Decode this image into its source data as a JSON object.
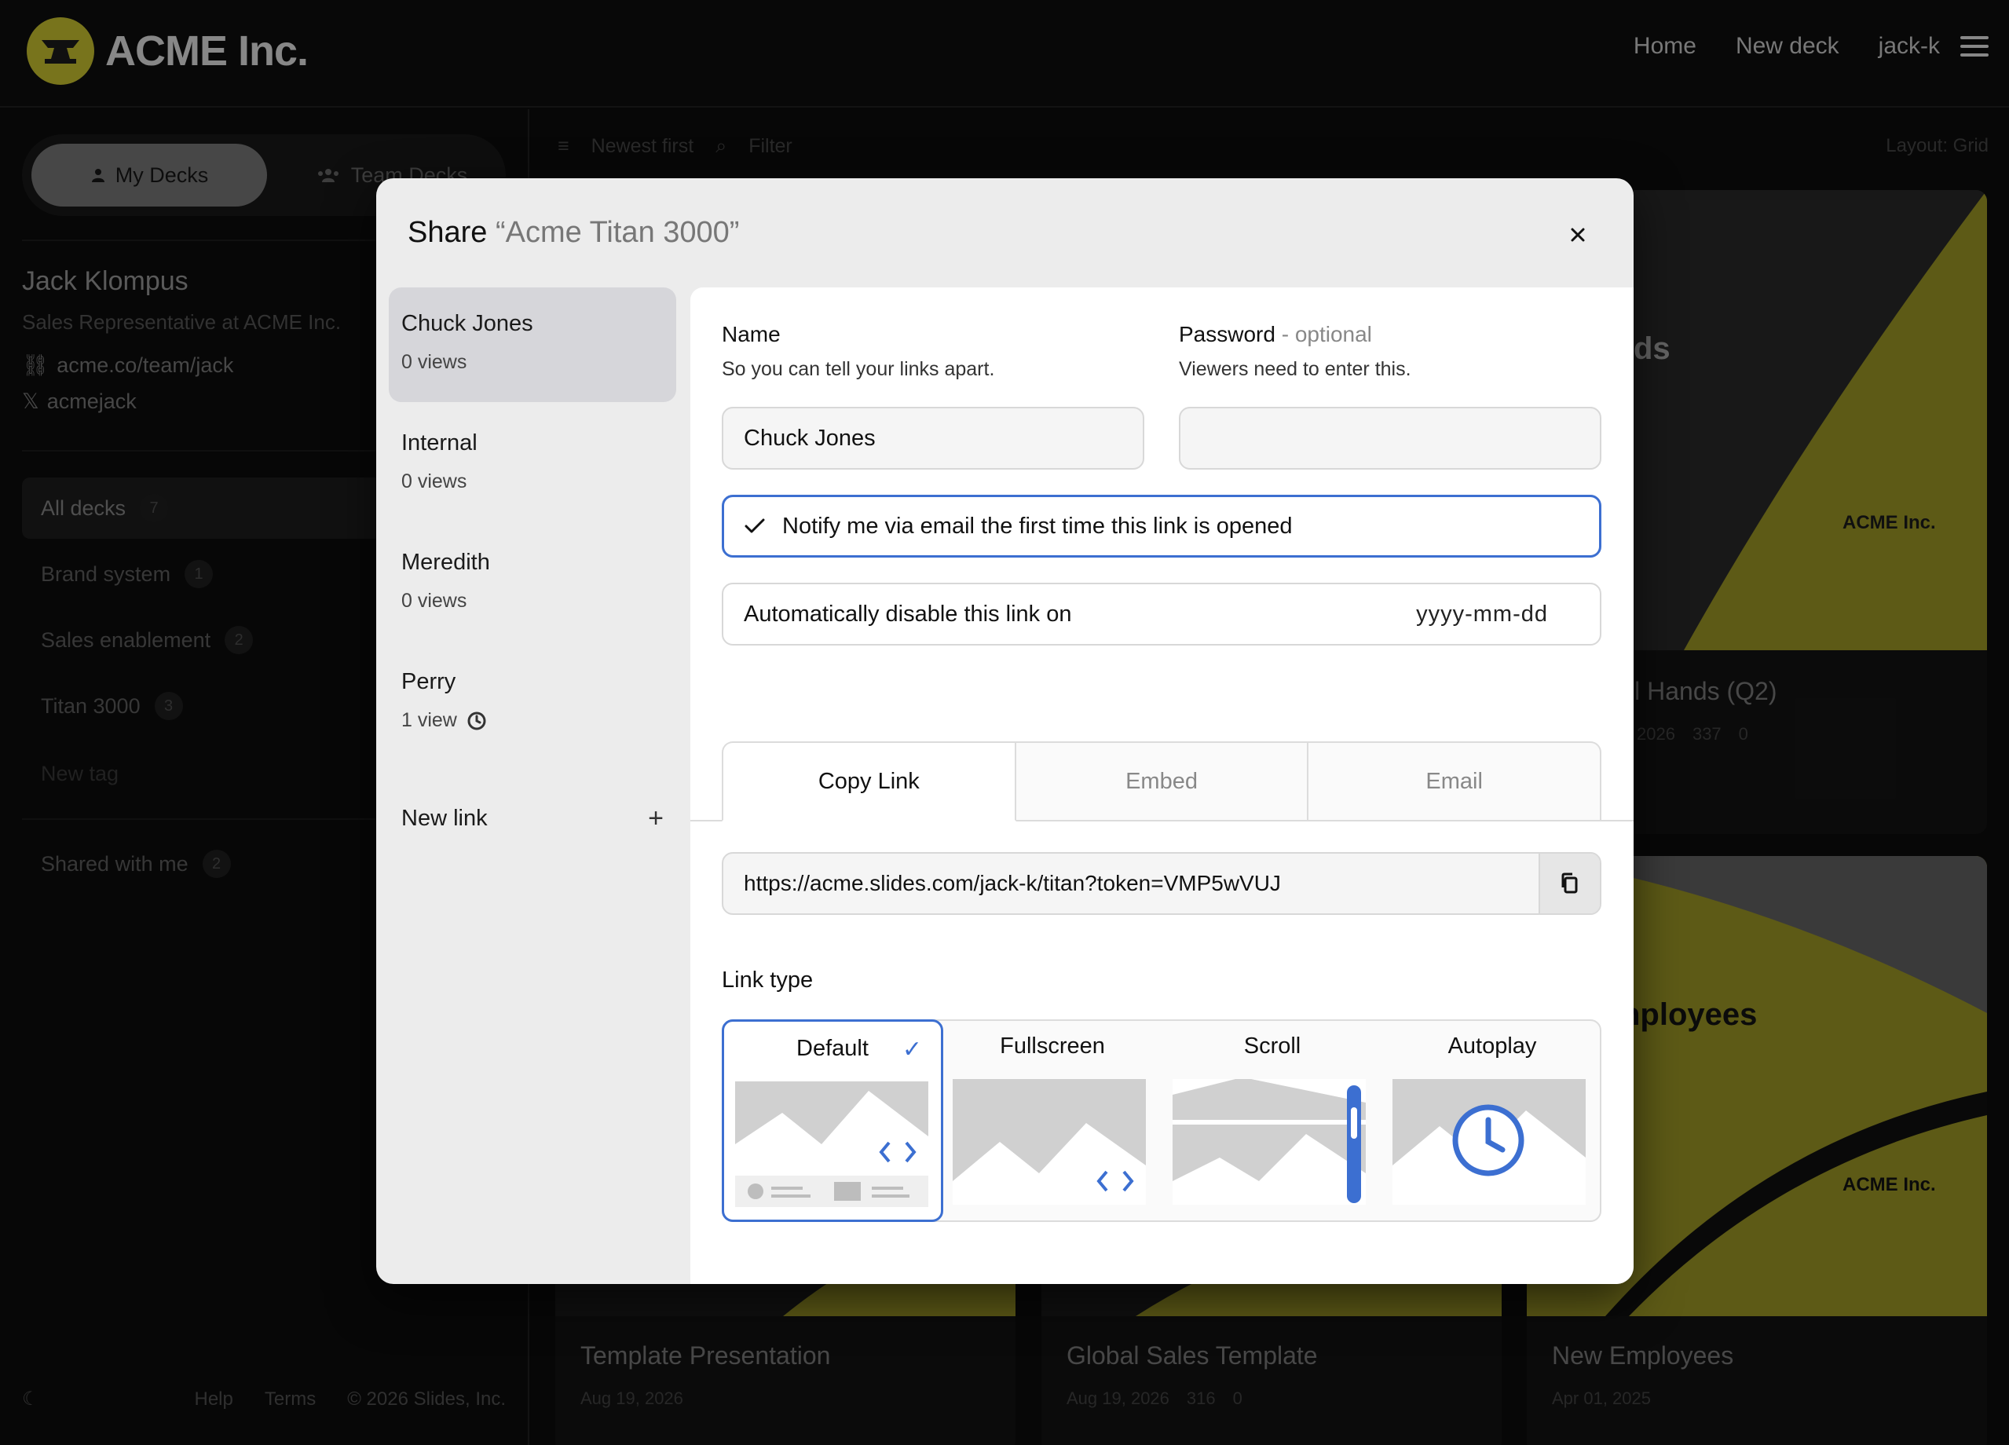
{
  "app": {
    "brand": "ACME Inc.",
    "nav": {
      "home": "Home",
      "new_deck": "New deck",
      "user": "jack-k"
    }
  },
  "sidebar": {
    "tabs": {
      "my_decks": "My Decks",
      "team_decks": "Team Decks"
    },
    "profile": {
      "name": "Jack Klompus",
      "role": "Sales Representative at ACME Inc.",
      "link": "acme.co/team/jack",
      "x_handle": "acmejack"
    },
    "tags": [
      {
        "label": "All decks",
        "count": "7"
      },
      {
        "label": "Brand system",
        "count": "1"
      },
      {
        "label": "Sales enablement",
        "count": "2"
      },
      {
        "label": "Titan 3000",
        "count": "3"
      }
    ],
    "new_tag": "New tag",
    "shared": {
      "label": "Shared with me",
      "count": "2"
    },
    "footer": {
      "help": "Help",
      "terms": "Terms",
      "copyright": "© 2026 Slides, Inc."
    }
  },
  "main": {
    "sort": "Newest first",
    "filter": "Filter",
    "layout": "Layout: Grid",
    "cards": [
      {
        "title": "ll Hands (Q2)",
        "date": "2026",
        "views": "337",
        "likes": "0"
      },
      {
        "title": "Template Presentation",
        "date": "Aug 19, 2026"
      },
      {
        "title": "Global Sales Template",
        "date": "Aug 19, 2026",
        "views": "316",
        "likes": "0"
      },
      {
        "title": "New Employees",
        "date": "Apr 01, 2025"
      }
    ],
    "card_text": {
      "ds": "ds",
      "mployees": "nployees",
      "brand": "ACME Inc."
    }
  },
  "modal": {
    "title_prefix": "Share",
    "deck_name": "“Acme Titan 3000”",
    "links": [
      {
        "name": "Chuck Jones",
        "views": "0 views"
      },
      {
        "name": "Internal",
        "views": "0 views"
      },
      {
        "name": "Meredith",
        "views": "0 views"
      },
      {
        "name": "Perry",
        "views": "1 view"
      }
    ],
    "new_link": "New link",
    "name_label": "Name",
    "name_hint": "So you can tell your links apart.",
    "name_value": "Chuck Jones",
    "password_label": "Password",
    "password_optional": "- optional",
    "password_hint": "Viewers need to enter this.",
    "password_value": "",
    "notify_label": "Notify me via email the first time this link is opened",
    "notify_checked": true,
    "disable_label": "Automatically disable this link on",
    "disable_placeholder": "yyyy-mm-dd",
    "tabs": [
      "Copy Link",
      "Embed",
      "Email"
    ],
    "url": "https://acme.slides.com/jack-k/titan?token=VMP5wVUJ",
    "link_type_label": "Link type",
    "link_types": [
      "Default",
      "Fullscreen",
      "Scroll",
      "Autoplay"
    ],
    "selected_link_type": "Default",
    "accent_color": "#3c6fd1"
  }
}
